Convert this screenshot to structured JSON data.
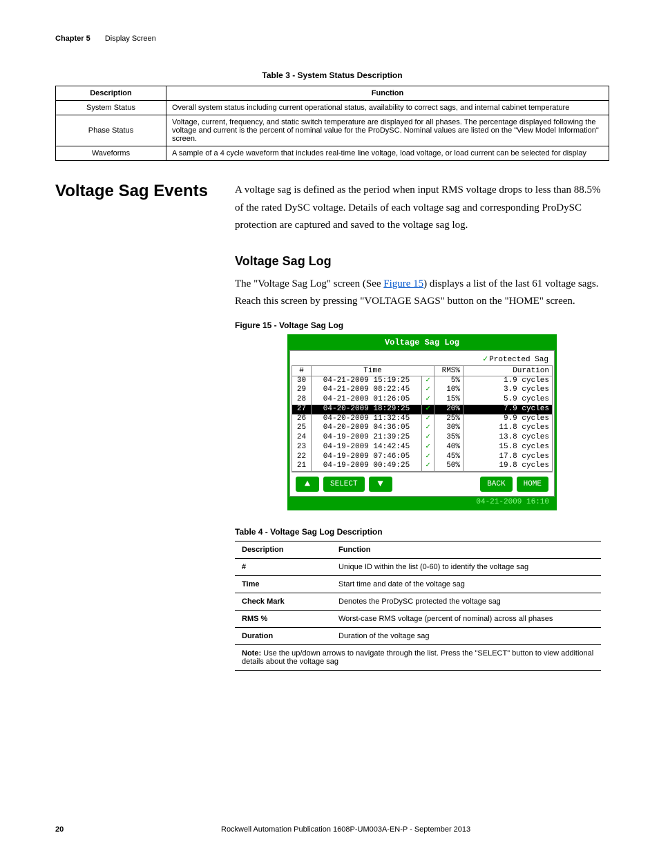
{
  "header": {
    "chapter": "Chapter 5",
    "title": "Display Screen"
  },
  "table3": {
    "caption": "Table 3 - System Status Description",
    "head": {
      "c1": "Description",
      "c2": "Function"
    },
    "rows": [
      {
        "d": "System Status",
        "f": "Overall system status including current operational status, availability to correct sags, and internal cabinet temperature"
      },
      {
        "d": "Phase Status",
        "f": "Voltage, current, frequency, and static switch temperature are displayed for all phases. The percentage displayed following the voltage and current is the percent of nominal value for the ProDySC. Nominal values are listed on the \"View Model Information\" screen."
      },
      {
        "d": "Waveforms",
        "f": "A sample of a 4 cycle waveform that includes real-time line voltage, load voltage, or load current can be selected for display"
      }
    ]
  },
  "section": {
    "title": "Voltage Sag Events",
    "para1": "A voltage sag is defined as the period when input RMS voltage drops to less than 88.5% of the rated DySC voltage. Details of each voltage sag and corresponding ProDySC protection are captured and saved to the voltage sag log.",
    "sub": "Voltage Sag Log",
    "para2a": "The \"Voltage Sag Log\" screen (See ",
    "para2link": "Figure 15",
    "para2b": ") displays a list of the last 61 voltage sags. Reach this screen by pressing \"VOLTAGE SAGS\" button on the \"HOME\" screen.",
    "figcap": "Figure 15 - Voltage Sag Log"
  },
  "screen": {
    "title": "Voltage Sag Log",
    "protected": "Protected Sag",
    "head": {
      "n": "#",
      "t": "Time",
      "r": "RMS%",
      "d": "Duration"
    },
    "rows": [
      {
        "n": "30",
        "t": "04-21-2009 15:19:25",
        "r": "5%",
        "d": "1.9 cycles",
        "sel": false
      },
      {
        "n": "29",
        "t": "04-21-2009 08:22:45",
        "r": "10%",
        "d": "3.9 cycles",
        "sel": false
      },
      {
        "n": "28",
        "t": "04-21-2009 01:26:05",
        "r": "15%",
        "d": "5.9 cycles",
        "sel": false
      },
      {
        "n": "27",
        "t": "04-20-2009 18:29:25",
        "r": "20%",
        "d": "7.9 cycles",
        "sel": true
      },
      {
        "n": "26",
        "t": "04-20-2009 11:32:45",
        "r": "25%",
        "d": "9.9 cycles",
        "sel": false
      },
      {
        "n": "25",
        "t": "04-20-2009 04:36:05",
        "r": "30%",
        "d": "11.8 cycles",
        "sel": false
      },
      {
        "n": "24",
        "t": "04-19-2009 21:39:25",
        "r": "35%",
        "d": "13.8 cycles",
        "sel": false
      },
      {
        "n": "23",
        "t": "04-19-2009 14:42:45",
        "r": "40%",
        "d": "15.8 cycles",
        "sel": false
      },
      {
        "n": "22",
        "t": "04-19-2009 07:46:05",
        "r": "45%",
        "d": "17.8 cycles",
        "sel": false
      },
      {
        "n": "21",
        "t": "04-19-2009 00:49:25",
        "r": "50%",
        "d": "19.8 cycles",
        "sel": false
      }
    ],
    "btns": {
      "select": "SELECT",
      "back": "BACK",
      "home": "HOME"
    },
    "timestamp": "04-21-2009 16:10"
  },
  "table4": {
    "caption": "Table 4 - Voltage Sag Log Description",
    "head": {
      "c1": "Description",
      "c2": "Function"
    },
    "rows": [
      {
        "d": "#",
        "f": "Unique ID within the list (0-60) to identify the voltage sag"
      },
      {
        "d": "Time",
        "f": "Start time and date of the voltage sag"
      },
      {
        "d": "Check Mark",
        "f": "Denotes the ProDySC protected the voltage sag"
      },
      {
        "d": "RMS %",
        "f": "Worst-case RMS voltage (percent of nominal) across all phases"
      },
      {
        "d": "Duration",
        "f": "Duration of the voltage sag"
      }
    ],
    "noteLabel": "Note:",
    "note": " Use the up/down arrows to navigate through the list. Press the \"SELECT\" button to view additional details about the voltage sag"
  },
  "footer": {
    "page": "20",
    "pub": "Rockwell Automation Publication 1608P-UM003A-EN-P - September 2013"
  }
}
